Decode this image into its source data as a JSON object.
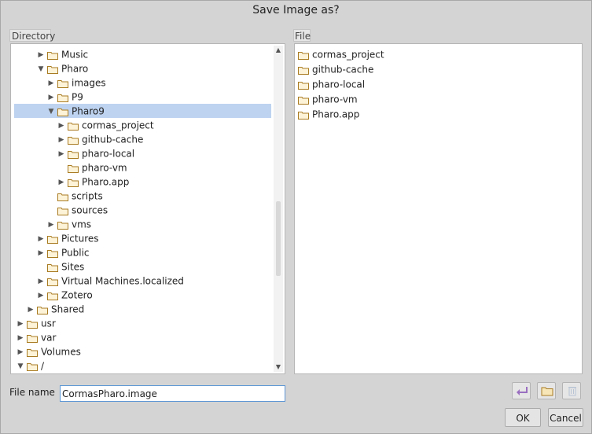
{
  "dialog": {
    "title": "Save Image as?"
  },
  "directory": {
    "label": "Directory",
    "items": [
      {
        "name": "Music",
        "indent": 2,
        "arrow": "collapsed"
      },
      {
        "name": "Pharo",
        "indent": 2,
        "arrow": "expanded"
      },
      {
        "name": "images",
        "indent": 3,
        "arrow": "collapsed"
      },
      {
        "name": "P9",
        "indent": 3,
        "arrow": "collapsed"
      },
      {
        "name": "Pharo9",
        "indent": 3,
        "arrow": "expanded",
        "selected": true
      },
      {
        "name": "cormas_project",
        "indent": 4,
        "arrow": "collapsed"
      },
      {
        "name": "github-cache",
        "indent": 4,
        "arrow": "collapsed"
      },
      {
        "name": "pharo-local",
        "indent": 4,
        "arrow": "collapsed"
      },
      {
        "name": "pharo-vm",
        "indent": 4,
        "arrow": "none"
      },
      {
        "name": "Pharo.app",
        "indent": 4,
        "arrow": "collapsed"
      },
      {
        "name": "scripts",
        "indent": 3,
        "arrow": "none"
      },
      {
        "name": "sources",
        "indent": 3,
        "arrow": "none"
      },
      {
        "name": "vms",
        "indent": 3,
        "arrow": "collapsed"
      },
      {
        "name": "Pictures",
        "indent": 2,
        "arrow": "collapsed"
      },
      {
        "name": "Public",
        "indent": 2,
        "arrow": "collapsed"
      },
      {
        "name": "Sites",
        "indent": 2,
        "arrow": "none"
      },
      {
        "name": "Virtual Machines.localized",
        "indent": 2,
        "arrow": "collapsed"
      },
      {
        "name": "Zotero",
        "indent": 2,
        "arrow": "collapsed"
      },
      {
        "name": "Shared",
        "indent": 1,
        "arrow": "collapsed"
      },
      {
        "name": "usr",
        "indent": 0,
        "arrow": "collapsed"
      },
      {
        "name": "var",
        "indent": 0,
        "arrow": "collapsed"
      },
      {
        "name": "Volumes",
        "indent": 0,
        "arrow": "collapsed"
      },
      {
        "name": "/",
        "indent": 0,
        "arrow": "expanded"
      }
    ]
  },
  "files": {
    "label": "File",
    "items": [
      "cormas_project",
      "github-cache",
      "pharo-local",
      "pharo-vm",
      "Pharo.app"
    ]
  },
  "filename": {
    "label": "File name",
    "value": "CormasPharo.image"
  },
  "buttons": {
    "ok": "OK",
    "cancel": "Cancel"
  },
  "icons": {
    "folder": "folder-icon",
    "back": "back-arrow-icon",
    "new_folder": "new-folder-icon",
    "delete": "trash-icon"
  }
}
